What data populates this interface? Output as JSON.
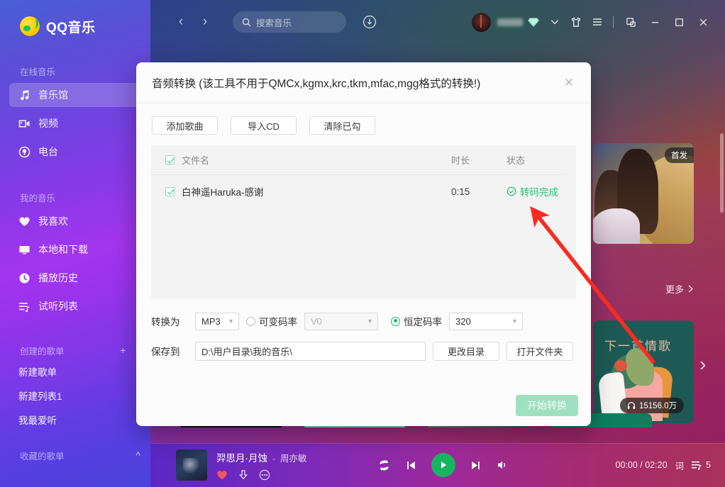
{
  "app": {
    "logo_text": "QQ音乐"
  },
  "sidebar": {
    "sections": [
      {
        "label": "在线音乐",
        "items": [
          {
            "label": "音乐馆",
            "icon": "music-note-icon",
            "active": true
          },
          {
            "label": "视频",
            "icon": "video-camera-icon",
            "active": false
          },
          {
            "label": "电台",
            "icon": "radio-icon",
            "active": false
          }
        ]
      },
      {
        "label": "我的音乐",
        "items": [
          {
            "label": "我喜欢",
            "icon": "heart-icon",
            "active": false
          },
          {
            "label": "本地和下载",
            "icon": "monitor-icon",
            "active": false
          },
          {
            "label": "播放历史",
            "icon": "clock-icon",
            "active": false
          },
          {
            "label": "试听列表",
            "icon": "playlist-icon",
            "active": false
          }
        ]
      }
    ],
    "created_playlists": {
      "label": "创建的歌单",
      "add_icon": "plus-icon",
      "collapse_icon": "chevron-up-icon",
      "items": [
        "新建歌单",
        "新建列表1",
        "我最爱听"
      ]
    },
    "favorite_playlists": {
      "label": "收藏的歌单",
      "collapse_icon": "chevron-up-icon"
    }
  },
  "topbar": {
    "back_icon": "chevron-left-icon",
    "forward_icon": "chevron-right-icon",
    "search": {
      "icon": "search-icon",
      "placeholder": "搜索音乐",
      "value": ""
    },
    "download_icon": "download-manager-icon",
    "avatar": "user-avatar",
    "username_blurred": "",
    "vip_icon": "diamond-icon",
    "dropdown_icon": "chevron-down-icon",
    "skin_icon": "shirt-icon",
    "menu_icon": "hamburger-menu-icon",
    "mini_icon": "mini-window-icon",
    "minimize_icon": "minimize-icon",
    "maximize_icon": "maximize-icon",
    "close_icon": "close-icon"
  },
  "background_content": {
    "featured_card": {
      "badge": "首发"
    },
    "more_label": "更多",
    "more_icon": "chevron-right-icon",
    "illustration_card": {
      "title": "下一首情歌",
      "play_count": "15156.0万",
      "headphone_icon": "headphone-icon"
    },
    "carousel_next_icon": "chevron-right-icon"
  },
  "dialog": {
    "title": "音频转换 (该工具不用于QMCx,kgmx,krc,tkm,mfac,mgg格式的转换!)",
    "close_icon": "close-icon",
    "toolbar": {
      "add_songs": "添加歌曲",
      "import_cd": "导入CD",
      "clear_checked": "清除已勾"
    },
    "table": {
      "headers": {
        "name": "文件名",
        "duration": "时长",
        "status": "状态"
      },
      "header_checkbox_checked": true,
      "rows": [
        {
          "checked": true,
          "name": "白神遥Haruka-感谢",
          "duration": "0:15",
          "status": "转码完成",
          "status_icon": "check-circle-icon",
          "status_color": "#25c274"
        }
      ]
    },
    "form": {
      "convert_label": "转换为",
      "format_value": "MP3",
      "vbr": {
        "label": "可变码率",
        "selected": false,
        "value": "V0",
        "disabled": true
      },
      "cbr": {
        "label": "恒定码率",
        "selected": true,
        "value": "320"
      },
      "save_label": "保存到",
      "save_path": "D:\\用户目录\\我的音乐\\",
      "change_dir_button": "更改目录",
      "open_folder_button": "打开文件夹"
    },
    "start_button": "开始转换"
  },
  "player": {
    "song": "羿思月·月蚀",
    "separator": "-",
    "artist": "周亦敏",
    "like_icon": "heart-filled-icon",
    "download_icon": "download-icon",
    "more_icon": "more-dots-icon",
    "repeat_icon": "repeat-icon",
    "prev_icon": "previous-track-icon",
    "play_icon": "play-icon",
    "next_icon": "next-track-icon",
    "volume_icon": "volume-icon",
    "time": "00:00 / 02:20",
    "lyrics_label": "词",
    "queue_icon": "playlist-queue-icon",
    "queue_count": "5"
  },
  "annotation": {
    "arrow_color": "#fa2b20"
  }
}
